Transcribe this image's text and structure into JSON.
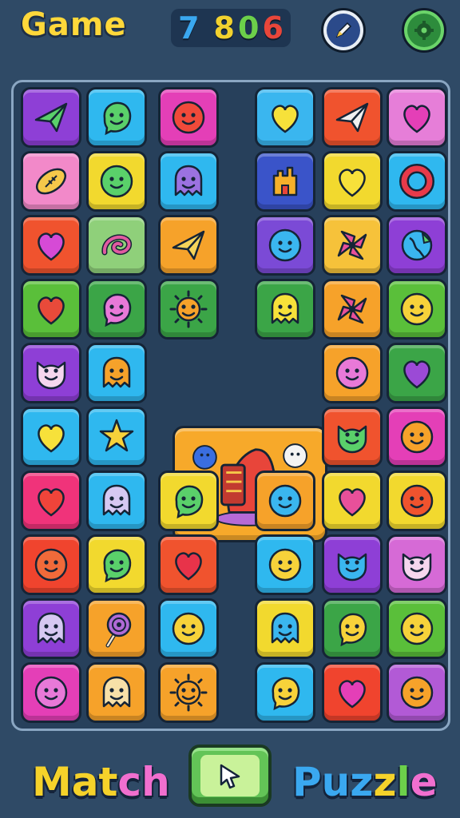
{
  "header": {
    "title": "Game",
    "score_digits": [
      {
        "digit": "7",
        "color": "#3aa8f0"
      },
      {
        "digit": "8",
        "color": "#f2d22e"
      },
      {
        "digit": "0",
        "color": "#6cd04a"
      },
      {
        "digit": "6",
        "color": "#e8463a"
      }
    ],
    "edit_button_icon": "pencil-icon",
    "settings_button_icon": "gear-icon"
  },
  "footer": {
    "match_letters": [
      {
        "ch": "M",
        "color": "#f5d22a"
      },
      {
        "ch": "a",
        "color": "#f5d22a"
      },
      {
        "ch": "t",
        "color": "#f5d22a"
      },
      {
        "ch": "c",
        "color": "#f16fcf"
      },
      {
        "ch": "h",
        "color": "#f16fcf"
      }
    ],
    "puzzle_letters": [
      {
        "ch": "P",
        "color": "#3aa8f0"
      },
      {
        "ch": "u",
        "color": "#3aa8f0"
      },
      {
        "ch": "z",
        "color": "#3aa8f0"
      },
      {
        "ch": "z",
        "color": "#f5d22a"
      },
      {
        "ch": "l",
        "color": "#6cd04a"
      },
      {
        "ch": "e",
        "color": "#f16fcf"
      }
    ],
    "play_button_icon": "cursor-icon"
  },
  "board": {
    "center_piece": {
      "icon": "red-creature-machine-icon",
      "bg": "#f7a92a"
    },
    "tiles": [
      {
        "bg": "#8e3fd6",
        "icon": "plane",
        "ic": "#5ad06a"
      },
      {
        "bg": "#2fb8ef",
        "icon": "blob",
        "ic": "#5ad06a"
      },
      {
        "bg": "#e43fb7",
        "icon": "face",
        "ic": "#f04a3a"
      },
      {
        "bg": "#3ab6ef",
        "icon": "heart",
        "ic": "#f7e13a"
      },
      {
        "bg": "#f0532e",
        "icon": "plane",
        "ic": "#f0f0f0"
      },
      {
        "bg": "#e67ed8",
        "icon": "heart",
        "ic": "#e43fb7"
      },
      {
        "bg": "#f289c9",
        "icon": "football",
        "ic": "#f5c84a"
      },
      {
        "bg": "#f2d92e",
        "icon": "face",
        "ic": "#5ad06a"
      },
      {
        "bg": "#2fb8ef",
        "icon": "ghost",
        "ic": "#9b72e0"
      },
      {
        "bg": "#3a54c9",
        "icon": "castle",
        "ic": "#f5b02a"
      },
      {
        "bg": "#f2d92e",
        "icon": "heart",
        "ic": "#f7e13a"
      },
      {
        "bg": "#2fb8ef",
        "icon": "ring",
        "ic": "#e83a4a"
      },
      {
        "bg": "#f0532e",
        "icon": "heart",
        "ic": "#d64ad6"
      },
      {
        "bg": "#8fd07a",
        "icon": "swirl",
        "ic": "#e05aa0"
      },
      {
        "bg": "#f6a22a",
        "icon": "plane",
        "ic": "#f5d45a"
      },
      {
        "bg": "#7b4ad6",
        "icon": "face",
        "ic": "#3ab6ef"
      },
      {
        "bg": "#f6c23a",
        "icon": "pinwheel",
        "ic": "#e8509a"
      },
      {
        "bg": "#8e3fd6",
        "icon": "globe",
        "ic": "#3ab6ef"
      },
      {
        "bg": "#5abf3a",
        "icon": "heart",
        "ic": "#e84a3a"
      },
      {
        "bg": "#3ba547",
        "icon": "blob",
        "ic": "#e879d8"
      },
      {
        "bg": "#3ba547",
        "icon": "sun",
        "ic": "#f6a22a"
      },
      {
        "bg": "#3ba547",
        "icon": "ghost",
        "ic": "#f7e13a"
      },
      {
        "bg": "#f6a22a",
        "icon": "pinwheel",
        "ic": "#e8509a"
      },
      {
        "bg": "#5abf3a",
        "icon": "face",
        "ic": "#f7d23a"
      },
      {
        "bg": "#8e3fd6",
        "icon": "cat",
        "ic": "#f5d6ee"
      },
      {
        "bg": "#2fb8ef",
        "icon": "ghost",
        "ic": "#f6a22a"
      },
      {
        "bg": "#f6a22a",
        "icon": "face",
        "ic": "#e879d8"
      },
      {
        "bg": "#3ba547",
        "icon": "heart",
        "ic": "#9b4ad6"
      },
      {
        "bg": "#2fb8ef",
        "icon": "heart",
        "ic": "#f7e13a"
      },
      {
        "bg": "#2fb8ef",
        "icon": "star",
        "ic": "#f7d23a"
      },
      {
        "bg": "#f0532e",
        "icon": "cat",
        "ic": "#5ad06a"
      },
      {
        "bg": "#e43fb7",
        "icon": "face",
        "ic": "#f6a22a"
      },
      {
        "bg": "#f0337a",
        "icon": "heart",
        "ic": "#f0443a"
      },
      {
        "bg": "#2fb8ef",
        "icon": "ghost",
        "ic": "#d6c8f2"
      },
      {
        "bg": "#f2d92e",
        "icon": "blob",
        "ic": "#5ad06a"
      },
      {
        "bg": "#f6a22a",
        "icon": "face",
        "ic": "#3ab6ef"
      },
      {
        "bg": "#f2d92e",
        "icon": "heart",
        "ic": "#e8509a"
      },
      {
        "bg": "#f2d92e",
        "icon": "face",
        "ic": "#f0532e"
      },
      {
        "bg": "#f0442e",
        "icon": "face",
        "ic": "#f06a3a"
      },
      {
        "bg": "#f2d92e",
        "icon": "blob",
        "ic": "#5ad06a"
      },
      {
        "bg": "#f0532e",
        "icon": "heart",
        "ic": "#e8334a"
      },
      {
        "bg": "#2fb8ef",
        "icon": "face",
        "ic": "#f7d23a"
      },
      {
        "bg": "#8e3fd6",
        "icon": "cat",
        "ic": "#3ab6ef"
      },
      {
        "bg": "#d66ad6",
        "icon": "cat",
        "ic": "#f5d6ee"
      },
      {
        "bg": "#8e3fd6",
        "icon": "ghost",
        "ic": "#d6c8f2"
      },
      {
        "bg": "#f6a22a",
        "icon": "lollipop",
        "ic": "#b06ad6"
      },
      {
        "bg": "#2fb8ef",
        "icon": "face",
        "ic": "#f7d23a"
      },
      {
        "bg": "#f2d92e",
        "icon": "ghost",
        "ic": "#3ab6ef"
      },
      {
        "bg": "#3ba547",
        "icon": "blob",
        "ic": "#f7d23a"
      },
      {
        "bg": "#5abf3a",
        "icon": "face",
        "ic": "#f7d23a"
      },
      {
        "bg": "#e43fb7",
        "icon": "face",
        "ic": "#e879d8"
      },
      {
        "bg": "#f6a22a",
        "icon": "ghost",
        "ic": "#f7e0a8"
      },
      {
        "bg": "#f6a22a",
        "icon": "sun",
        "ic": "#f6a22a"
      },
      {
        "bg": "#2fb8ef",
        "icon": "blob",
        "ic": "#f7d23a"
      },
      {
        "bg": "#f0442e",
        "icon": "heart",
        "ic": "#e43fb7"
      },
      {
        "bg": "#b25ad6",
        "icon": "face",
        "ic": "#f6a22a"
      }
    ]
  }
}
